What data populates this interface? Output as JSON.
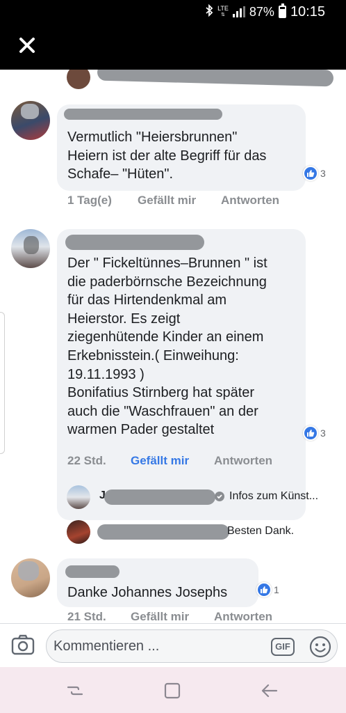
{
  "status_bar": {
    "network": "LTE",
    "battery_percent": "87%",
    "time": "10:15"
  },
  "header": {
    "close_icon": "close-icon"
  },
  "comments": [
    {
      "text": "Vermutlich \"Heiersbrunnen\"\nHeiern ist der alte Begriff für das\nSchafe– \"Hüten\".",
      "time": "1 Tag(e)",
      "like_label": "Gefällt mir",
      "reply_label": "Antworten",
      "reaction_count": "3",
      "liked": false
    },
    {
      "text": "Der \" Fickeltünnes–Brunnen \" ist\ndie paderbörnsche Bezeichnung\nfür das Hirtendenkmal am\nHeierstor. Es zeigt\nziegenhütende Kinder an einem\nErkebnisstein.( Einweihung:\n19.11.1993 )\nBonifatius Stirnberg hat später\nauch die \"Waschfrauen\" an der\nwarmen Pader gestaltet",
      "time": "22 Std.",
      "like_label": "Gefällt mir",
      "reply_label": "Antworten",
      "reaction_count": "3",
      "liked": true
    },
    {
      "text": "Danke Johannes Josephs",
      "time": "21 Std.",
      "like_label": "Gefällt mir",
      "reply_label": "Antworten",
      "reaction_count": "1",
      "liked": false
    }
  ],
  "replies": [
    {
      "name_fragment": "J",
      "text": "Infos zum Künst..."
    },
    {
      "text": "Besten Dank."
    }
  ],
  "composer": {
    "placeholder": "Kommentieren ...",
    "gif_label": "GIF"
  },
  "navbar": {
    "items": [
      "recent-apps-icon",
      "home-icon",
      "back-icon"
    ]
  },
  "colors": {
    "accent_blue": "#3578e5",
    "bubble_bg": "#f0f2f5",
    "meta_gray": "#8a8d91",
    "nav_bg": "#f6e9ef"
  }
}
